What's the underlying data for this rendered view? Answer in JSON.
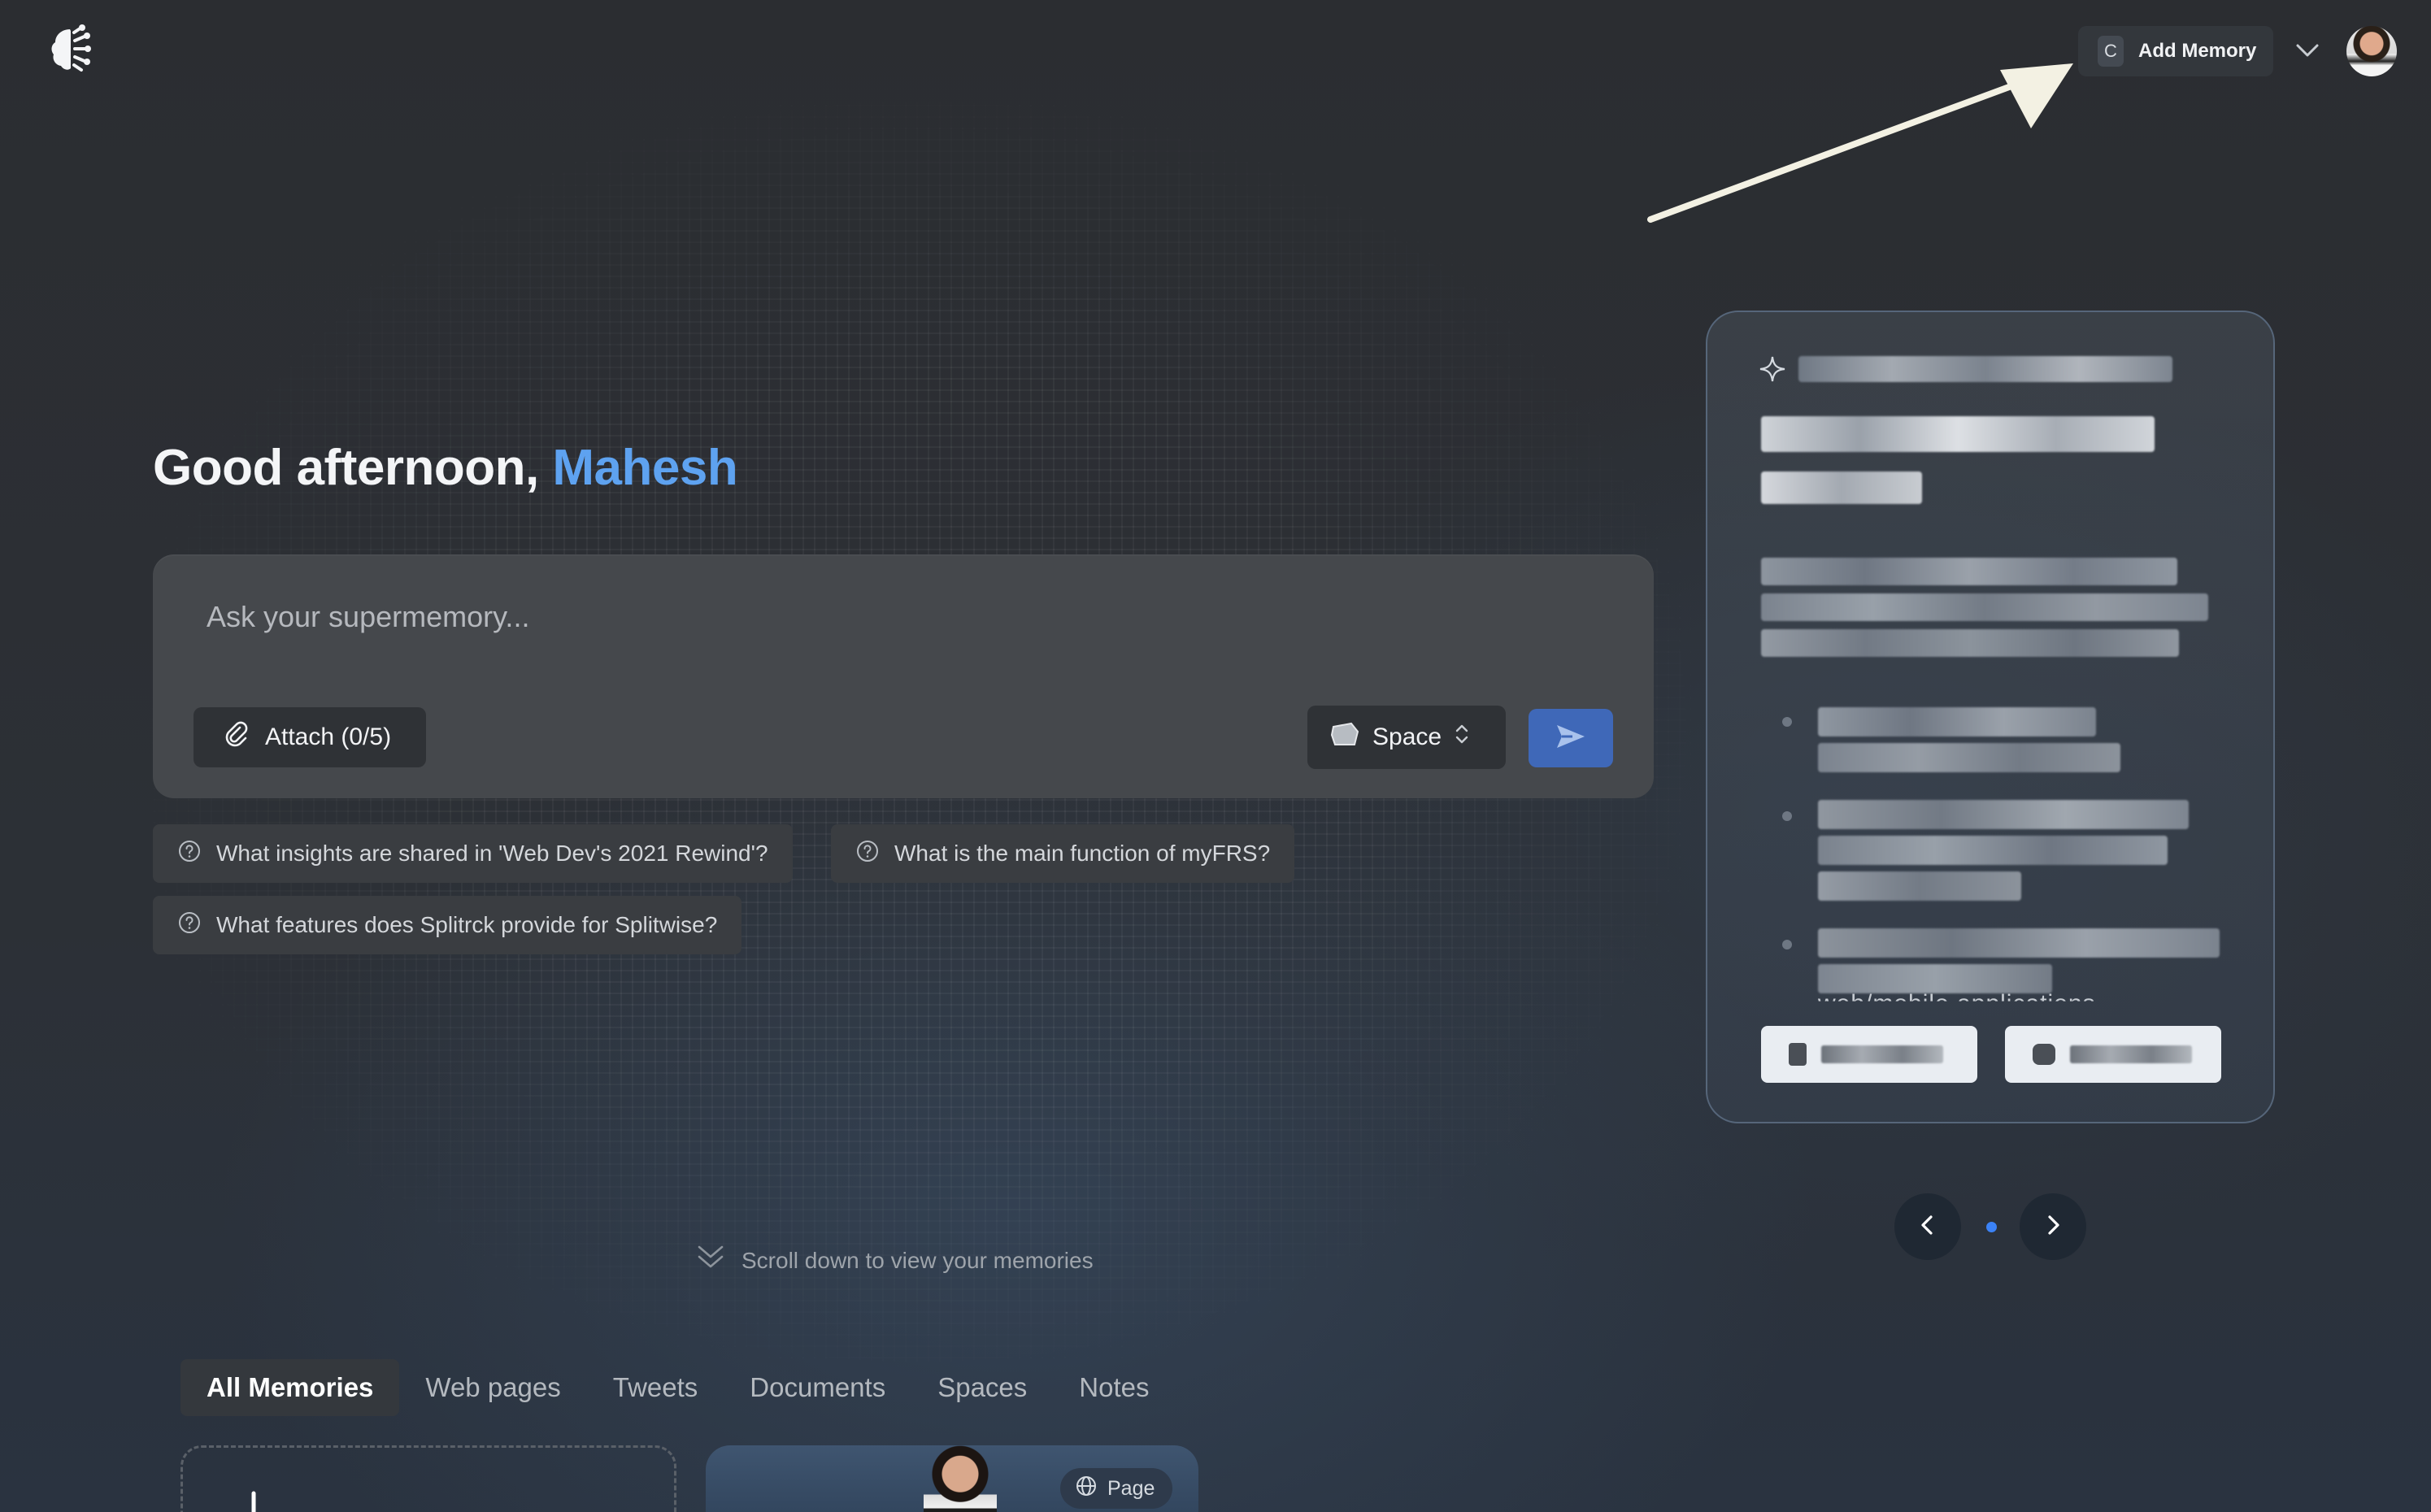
{
  "header": {
    "add_memory_shortcut": "C",
    "add_memory_label": "Add Memory"
  },
  "greeting": {
    "prefix": "Good afternoon, ",
    "name": "Mahesh"
  },
  "chat": {
    "placeholder": "Ask your supermemory...",
    "attach_label": "Attach (0/5)",
    "space_label": "Space"
  },
  "suggestions": [
    "What insights are shared in 'Web Dev's 2021 Rewind'?",
    "What is the main function of myFRS?",
    "What features does Splitrck provide for Splitwise?"
  ],
  "card": {
    "cutoff_text": "web/mobile applications"
  },
  "scroll_hint": "Scroll down to view your memories",
  "tabs": [
    "All Memories",
    "Web pages",
    "Tweets",
    "Documents",
    "Spaces",
    "Notes"
  ],
  "memory_card": {
    "badge": "Page"
  },
  "colors": {
    "accent": "#5ea2f0",
    "send_button": "#3f68b8",
    "carousel_dot": "#3b82f6"
  },
  "icons": [
    "brain-logo-icon",
    "chevron-down-icon",
    "paperclip-icon",
    "space-icon",
    "chevron-up-down-icon",
    "send-icon",
    "question-circle-icon",
    "sparkle-icon",
    "book-icon",
    "chevron-left-icon",
    "chevron-right-icon",
    "double-chevron-down-icon",
    "plus-icon",
    "globe-icon"
  ]
}
